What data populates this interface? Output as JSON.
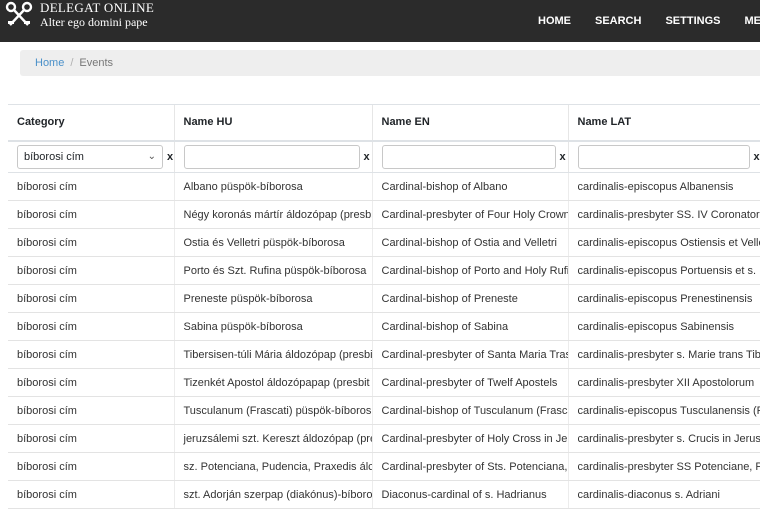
{
  "navbar": {
    "brand_title": "DELEGAT ONLINE",
    "brand_subtitle": "Alter ego domini pape",
    "menu": [
      "HOME",
      "SEARCH",
      "SETTINGS",
      "MENU"
    ]
  },
  "breadcrumb": {
    "home": "Home",
    "separator": "/",
    "current": "Events"
  },
  "table": {
    "headers": [
      "Category",
      "Name HU",
      "Name EN",
      "Name LAT"
    ],
    "filters": {
      "category_selected": "bíborosi cím",
      "name_hu": "",
      "name_en": "",
      "name_lat": "",
      "clear_label": "x"
    },
    "rows": [
      [
        "bíborosi cím",
        "Albano püspök-bíborosa",
        "Cardinal-bishop of Albano",
        "cardinalis-episcopus Albanensis"
      ],
      [
        "bíborosi cím",
        "Négy koronás mártír áldozópap (presbi",
        "Cardinal-presbyter of Four Holy Crowne",
        "cardinalis-presbyter SS. IV Coronatoru"
      ],
      [
        "bíborosi cím",
        "Ostia és Velletri püspök-bíborosa",
        "Cardinal-bishop of Ostia and Velletri",
        "cardinalis-episcopus Ostiensis et Velle"
      ],
      [
        "bíborosi cím",
        "Porto és Szt. Rufina püspök-bíborosa",
        "Cardinal-bishop of Porto and Holy Rufi",
        "cardinalis-episcopus Portuensis et s. R"
      ],
      [
        "bíborosi cím",
        "Preneste püspök-bíborosa",
        "Cardinal-bishop of Preneste",
        "cardinalis-episcopus Prenestinensis"
      ],
      [
        "bíborosi cím",
        "Sabina püspök-bíborosa",
        "Cardinal-bishop of Sabina",
        "cardinalis-episcopus Sabinensis"
      ],
      [
        "bíborosi cím",
        "Tibersisen-túli Mária áldozópap (presbi",
        "Cardinal-presbyter of Santa Maria Tras",
        "cardinalis-presbyter s. Marie trans Tibe"
      ],
      [
        "bíborosi cím",
        "Tizenkét Apostol áldozópapap (presbit",
        "Cardinal-presbyter of Twelf Apostels",
        "cardinalis-presbyter XII Apostolorum"
      ],
      [
        "bíborosi cím",
        "Tusculanum (Frascati) püspök-bíboros",
        "Cardinal-bishop of Tusculanum (Frasca",
        "cardinalis-episcopus Tusculanensis (Fr"
      ],
      [
        "bíborosi cím",
        "jeruzsálemi szt. Kereszt áldozópap (pre",
        "Cardinal-presbyter of Holy Cross in Jer",
        "cardinalis-presbyter s. Crucis in Jerusa"
      ],
      [
        "bíborosi cím",
        "sz. Potenciana, Pudencia, Praxedis álc",
        "Cardinal-presbyter of Sts. Potenciana,",
        "cardinalis-presbyter SS Potenciane, Pu"
      ],
      [
        "bíborosi cím",
        "szt. Adorján szerpap (diakónus)-bíboro",
        "Diaconus-cardinal of s. Hadrianus",
        "cardinalis-diaconus s. Adriani"
      ]
    ]
  }
}
